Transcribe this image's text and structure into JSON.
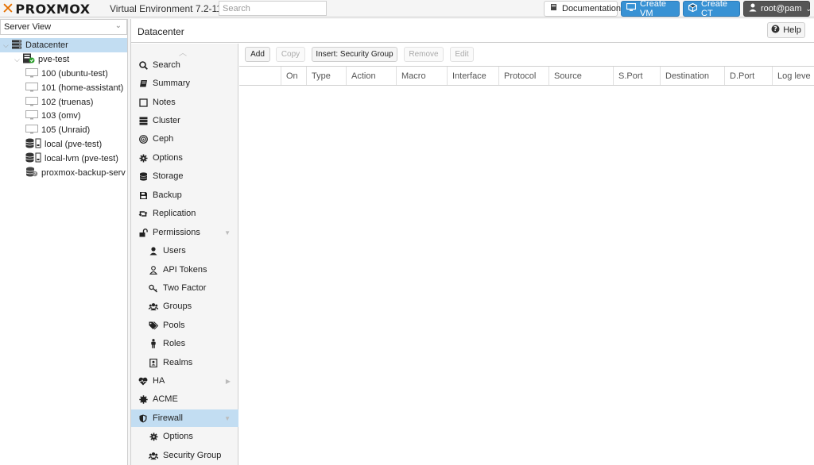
{
  "topbar": {
    "logo_text": "PROXMOX",
    "version": "Virtual Environment 7.2-11",
    "search_placeholder": "Search",
    "documentation_label": "Documentation",
    "create_vm_label": "Create VM",
    "create_ct_label": "Create CT",
    "user_label": "root@pam",
    "accent_color": "#3892d4",
    "logo_color": "#e57000"
  },
  "server_view": {
    "selector_label": "Server View",
    "tree": [
      {
        "label": "Datacenter",
        "icon": "datacenter-icon",
        "selected": true
      },
      {
        "label": "pve-test",
        "icon": "node-online-icon"
      },
      {
        "label": "100 (ubuntu-test)",
        "icon": "vm-icon"
      },
      {
        "label": "101 (home-assistant)",
        "icon": "vm-icon"
      },
      {
        "label": "102 (truenas)",
        "icon": "vm-icon"
      },
      {
        "label": "103 (omv)",
        "icon": "vm-icon"
      },
      {
        "label": "105 (Unraid)",
        "icon": "vm-icon"
      },
      {
        "label": "local (pve-test)",
        "icon": "storage-icon"
      },
      {
        "label": "local-lvm (pve-test)",
        "icon": "storage-icon"
      },
      {
        "label": "proxmox-backup-serv",
        "icon": "backup-storage-icon"
      }
    ]
  },
  "content": {
    "title": "Datacenter",
    "help_label": "Help"
  },
  "menu": {
    "items": [
      {
        "label": "Search",
        "icon": "search-icon"
      },
      {
        "label": "Summary",
        "icon": "book-icon"
      },
      {
        "label": "Notes",
        "icon": "notes-icon"
      },
      {
        "label": "Cluster",
        "icon": "server-icon"
      },
      {
        "label": "Ceph",
        "icon": "ceph-icon"
      },
      {
        "label": "Options",
        "icon": "gear-icon"
      },
      {
        "label": "Storage",
        "icon": "database-icon"
      },
      {
        "label": "Backup",
        "icon": "floppy-icon"
      },
      {
        "label": "Replication",
        "icon": "retweet-icon"
      },
      {
        "label": "Permissions",
        "icon": "unlock-icon"
      },
      {
        "label": "Users",
        "icon": "user-icon"
      },
      {
        "label": "API Tokens",
        "icon": "user-outline-icon"
      },
      {
        "label": "Two Factor",
        "icon": "key-icon"
      },
      {
        "label": "Groups",
        "icon": "users-icon"
      },
      {
        "label": "Pools",
        "icon": "tags-icon"
      },
      {
        "label": "Roles",
        "icon": "male-icon"
      },
      {
        "label": "Realms",
        "icon": "address-book-icon"
      },
      {
        "label": "HA",
        "icon": "heartbeat-icon"
      },
      {
        "label": "ACME",
        "icon": "certificate-icon"
      },
      {
        "label": "Firewall",
        "icon": "shield-icon"
      },
      {
        "label": "Options",
        "icon": "gear-icon"
      },
      {
        "label": "Security Group",
        "icon": "users-icon"
      }
    ]
  },
  "grid": {
    "buttons": {
      "add": "Add",
      "copy": "Copy",
      "insert_security_group": "Insert: Security Group",
      "remove": "Remove",
      "edit": "Edit"
    },
    "columns": [
      "On",
      "Type",
      "Action",
      "Macro",
      "Interface",
      "Protocol",
      "Source",
      "S.Port",
      "Destination",
      "D.Port",
      "Log leve"
    ]
  }
}
